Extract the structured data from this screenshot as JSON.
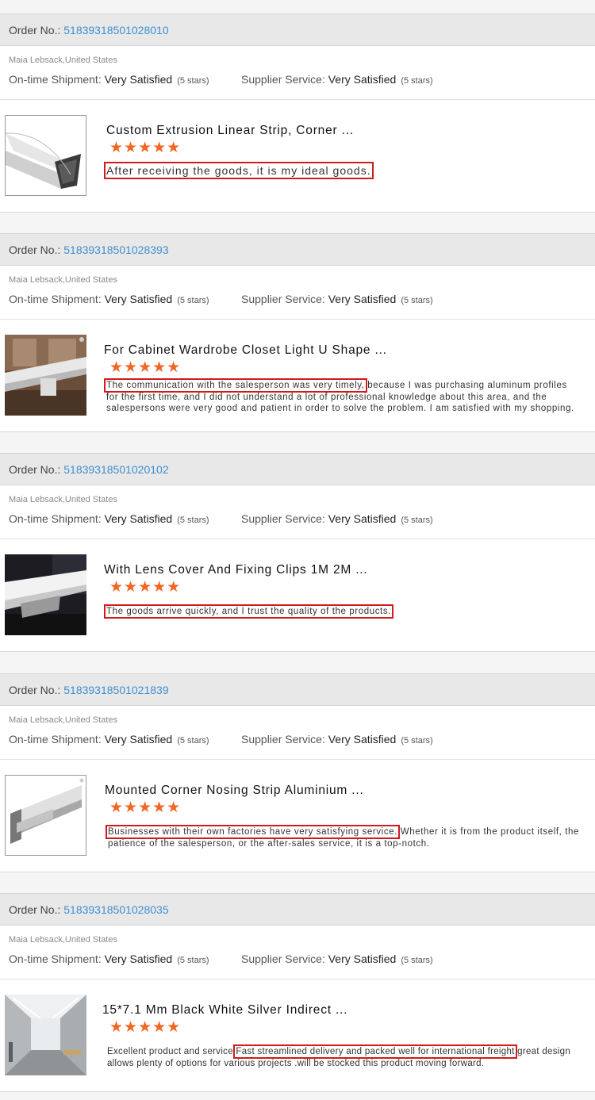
{
  "labels": {
    "order_no": "Order No.:",
    "on_time": "On-time Shipment:",
    "supplier": "Supplier Service:"
  },
  "reviews": [
    {
      "order_no": "51839318501028010",
      "buyer": "Maia Lebsack,United States",
      "on_time_value": "Very Satisfied",
      "on_time_stars": "(5 stars)",
      "supplier_value": "Very Satisfied",
      "supplier_stars": "(5 stars)",
      "title": "Custom Extrusion Linear Strip, Corner ...",
      "stars": "★★★★★",
      "comment_pre": "",
      "comment_highlight": "After receiving the goods, it is my ideal goods.",
      "comment_post": ""
    },
    {
      "order_no": "51839318501028393",
      "buyer": "Maia Lebsack,United States",
      "on_time_value": "Very Satisfied",
      "on_time_stars": "(5 stars)",
      "supplier_value": "Very Satisfied",
      "supplier_stars": "(5 stars)",
      "title": "For Cabinet Wardrobe Closet Light U Shape ...",
      "stars": "★★★★★",
      "comment_pre": "",
      "comment_highlight": "The communication with the salesperson was very timely,",
      "comment_post": " because I was purchasing aluminum profiles for the first time, and I did not understand a lot of professional knowledge about this area, and the salespersons were very good and patient in order to solve the problem. I am satisfied with my shopping."
    },
    {
      "order_no": "51839318501020102",
      "buyer": "Maia Lebsack,United States",
      "on_time_value": "Very Satisfied",
      "on_time_stars": "(5 stars)",
      "supplier_value": "Very Satisfied",
      "supplier_stars": "(5 stars)",
      "title": "With Lens Cover And Fixing Clips 1M 2M ...",
      "stars": "★★★★★",
      "comment_pre": "",
      "comment_highlight": "The goods arrive quickly, and I trust the quality of the products.",
      "comment_post": ""
    },
    {
      "order_no": "51839318501021839",
      "buyer": "Maia Lebsack,United States",
      "on_time_value": "Very Satisfied",
      "on_time_stars": "(5 stars)",
      "supplier_value": "Very Satisfied",
      "supplier_stars": "(5 stars)",
      "title": "Mounted Corner Nosing Strip Aluminium ...",
      "stars": "★★★★★",
      "comment_pre": "",
      "comment_highlight": "Businesses with their own factories have very satisfying service.",
      "comment_post": " Whether it is from the product itself, the patience of the salesperson, or the after-sales service, it is a top-notch."
    },
    {
      "order_no": "51839318501028035",
      "buyer": "Maia Lebsack,United States",
      "on_time_value": "Very Satisfied",
      "on_time_stars": "(5 stars)",
      "supplier_value": "Very Satisfied",
      "supplier_stars": "(5 stars)",
      "title": "15*7.1 Mm Black White Silver Indirect ...",
      "stars": "★★★★★",
      "comment_pre": "Excellent product and service ",
      "comment_highlight": "Fast streamlined delivery and packed well for international freight",
      "comment_post": " great design allows plenty of options for various projects .will be stocked this product  moving forward."
    }
  ]
}
